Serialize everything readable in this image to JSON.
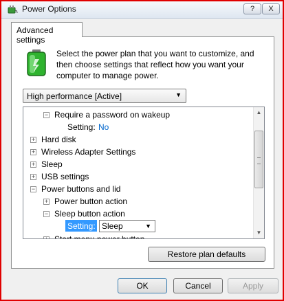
{
  "window": {
    "title": "Power Options",
    "help_label": "?",
    "close_label": "X"
  },
  "tab": {
    "label": "Advanced settings"
  },
  "description": "Select the power plan that you want to customize, and then choose settings that reflect how you want your computer to manage power.",
  "plan_select": {
    "value": "High performance [Active]"
  },
  "tree": {
    "items": [
      {
        "expander": "−",
        "label": "Require a password on wakeup"
      },
      {
        "setting_label": "Setting:",
        "setting_value": "No"
      },
      {
        "expander": "+",
        "label": "Hard disk"
      },
      {
        "expander": "+",
        "label": "Wireless Adapter Settings"
      },
      {
        "expander": "+",
        "label": "Sleep"
      },
      {
        "expander": "+",
        "label": "USB settings"
      },
      {
        "expander": "−",
        "label": "Power buttons and lid"
      },
      {
        "expander": "+",
        "label": "Power button action"
      },
      {
        "expander": "−",
        "label": "Sleep button action"
      },
      {
        "setting_label": "Setting:",
        "setting_value": "Sleep"
      },
      {
        "expander": "+",
        "label": "Start menu power button"
      }
    ]
  },
  "buttons": {
    "restore": "Restore plan defaults",
    "ok": "OK",
    "cancel": "Cancel",
    "apply": "Apply"
  },
  "icons": {
    "app": "power-plug-icon",
    "battery": "battery-icon"
  }
}
